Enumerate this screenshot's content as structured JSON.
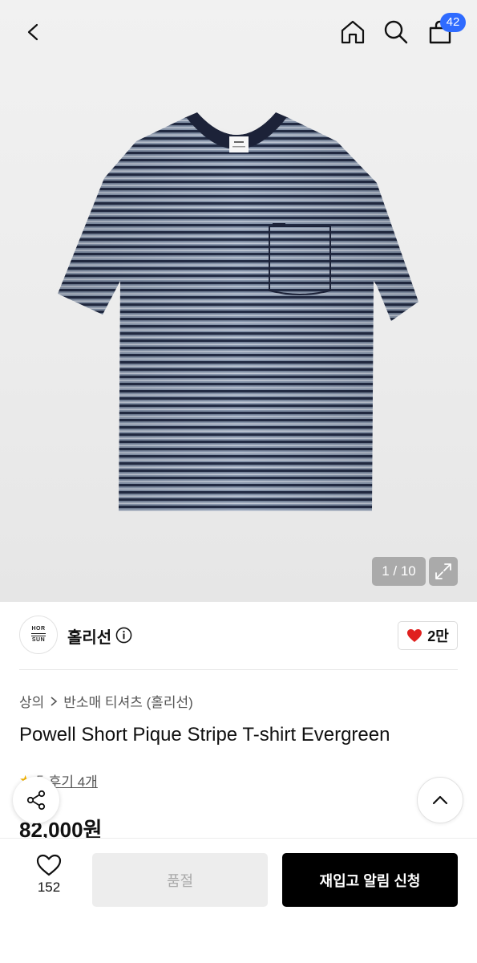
{
  "header": {
    "cart_count": "42"
  },
  "gallery": {
    "counter": "1 / 10"
  },
  "brand": {
    "logo_line1": "HOR",
    "logo_line2": "SUN",
    "name": "홀리선",
    "likes": "2만"
  },
  "breadcrumb": [
    "상의",
    "반소매 티셔츠 (홀리선)"
  ],
  "product": {
    "title": "Powell Short Pique Stripe T-shirt Evergreen",
    "rating": "5",
    "reviews_label": "후기 4개",
    "price": "82,000원"
  },
  "bottom_bar": {
    "wish_count": "152",
    "soldout_label": "품절",
    "restock_label": "재입고 알림 신청"
  },
  "colors": {
    "accent": "#2f6bff",
    "heart": "#e0201e",
    "cta": "#000000",
    "disabled": "#ededed"
  },
  "icons": [
    "back-icon",
    "home-icon",
    "search-icon",
    "bag-icon",
    "expand-icon",
    "info-icon",
    "heart-icon",
    "chevron-right-icon",
    "star-icon",
    "share-icon",
    "chevron-up-icon"
  ]
}
